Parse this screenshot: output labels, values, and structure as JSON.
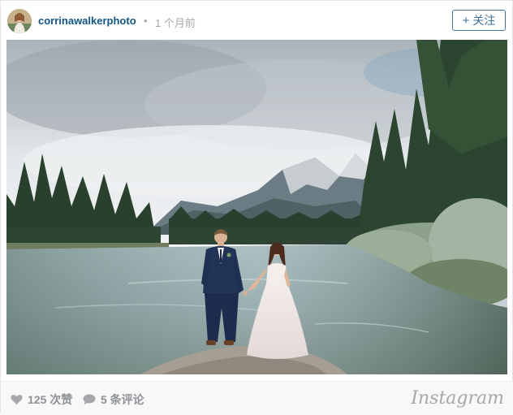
{
  "header": {
    "avatar_icon": "profile-avatar",
    "username": "corrinawalkerphoto",
    "separator": "•",
    "time_ago": "1 个月前",
    "follow_label": "关注",
    "follow_icon": "plus-icon"
  },
  "photo": {
    "subject": "wedding-couple-by-mountain-river"
  },
  "footer": {
    "likes_icon": "heart-icon",
    "likes_text": "125 次赞",
    "comments_icon": "comment-bubble-icon",
    "comments_text": "5 条评论",
    "brand": "Instagram"
  },
  "colors": {
    "username": "#125688",
    "follow_border": "#3f729b",
    "muted": "#a5a7aa",
    "footer_bg": "#f8f8f8"
  }
}
